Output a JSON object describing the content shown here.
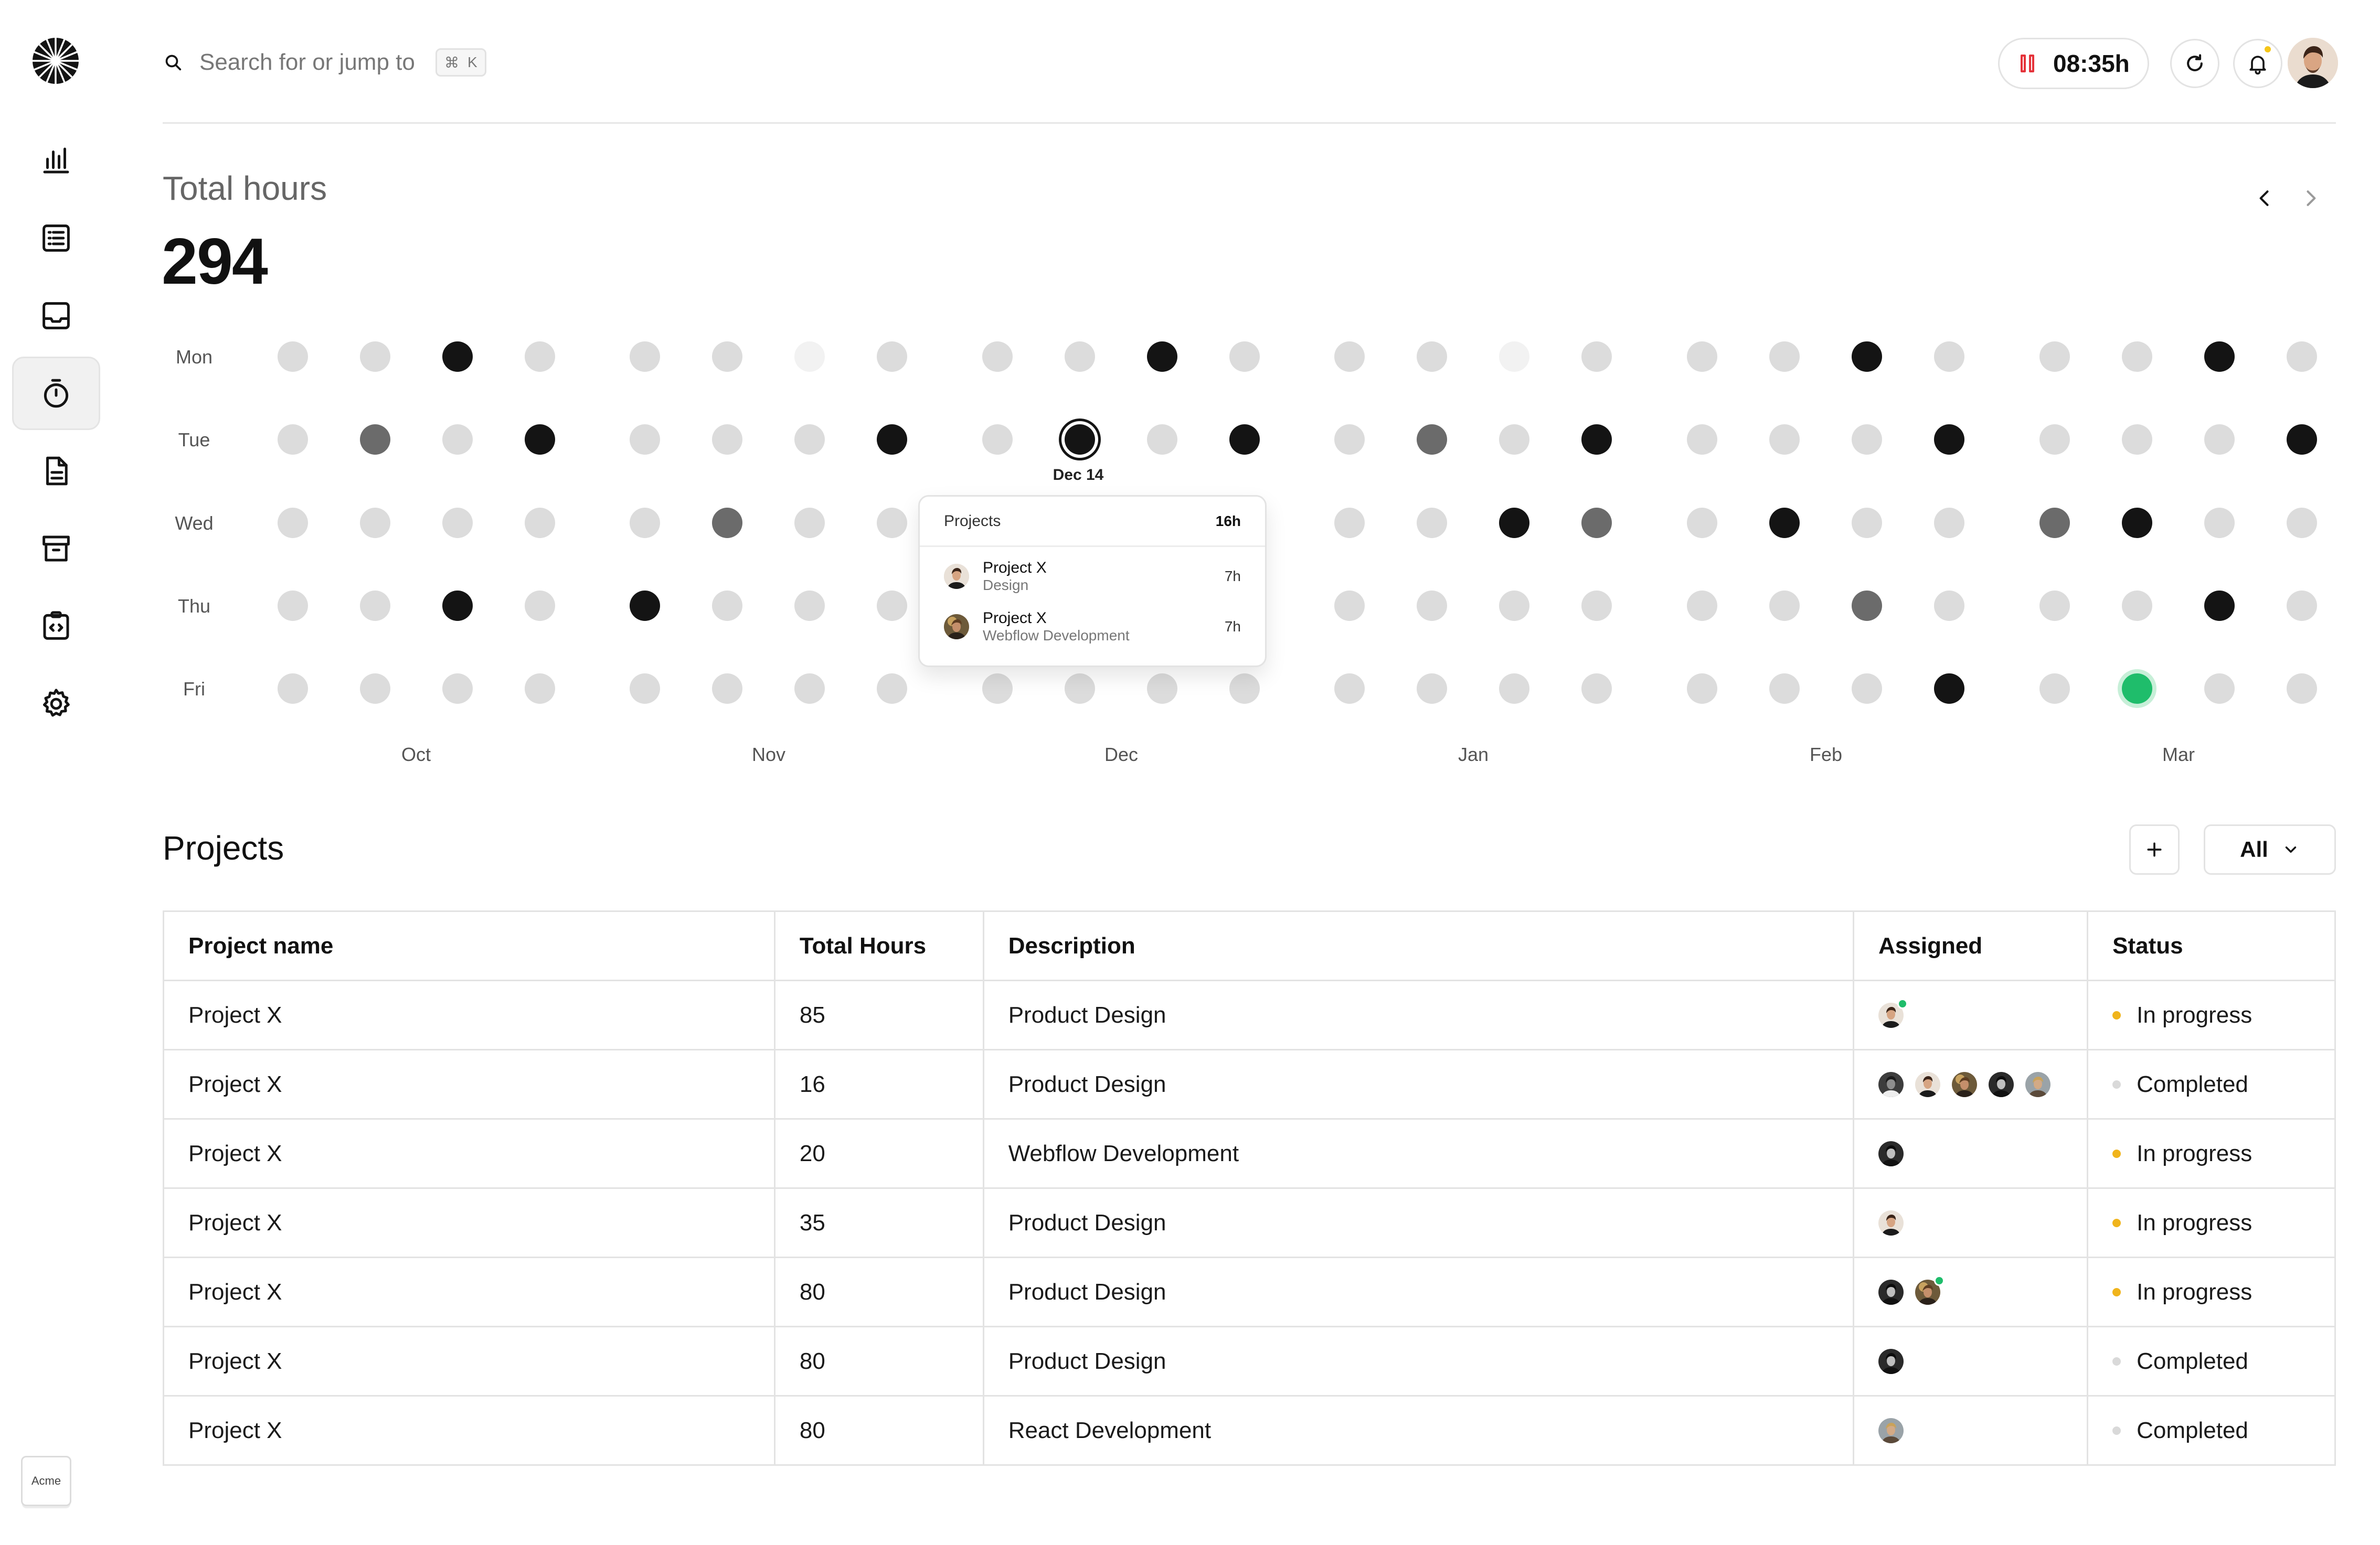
{
  "search": {
    "placeholder": "Search for or jump to",
    "shortcut_cmd": "⌘",
    "shortcut_key": "K"
  },
  "header": {
    "timer": "08:35h"
  },
  "summary": {
    "label": "Total hours",
    "value": "294"
  },
  "heatmap": {
    "days": [
      "Mon",
      "Tue",
      "Wed",
      "Thu",
      "Fri"
    ],
    "months": [
      "Oct",
      "Nov",
      "Dec",
      "Jan",
      "Feb",
      "Mar"
    ],
    "levels": [
      [
        1,
        1,
        3,
        1,
        1,
        1,
        0,
        1,
        1,
        1,
        3,
        1,
        1,
        1,
        0,
        1,
        1,
        1,
        3,
        1,
        1,
        1,
        3,
        1
      ],
      [
        1,
        2,
        1,
        3,
        1,
        1,
        1,
        3,
        1,
        "S",
        1,
        3,
        1,
        2,
        1,
        3,
        1,
        1,
        1,
        3,
        1,
        1,
        1,
        3
      ],
      [
        1,
        1,
        1,
        1,
        1,
        2,
        1,
        1,
        1,
        1,
        1,
        1,
        1,
        1,
        3,
        2,
        1,
        3,
        1,
        1,
        2,
        3,
        1,
        1
      ],
      [
        1,
        1,
        3,
        1,
        3,
        1,
        1,
        1,
        1,
        1,
        1,
        1,
        1,
        1,
        1,
        1,
        1,
        1,
        2,
        1,
        1,
        1,
        3,
        1
      ],
      [
        1,
        1,
        1,
        1,
        1,
        1,
        1,
        1,
        1,
        1,
        1,
        1,
        1,
        1,
        1,
        1,
        1,
        1,
        1,
        3,
        1,
        "T",
        1,
        1
      ]
    ],
    "selected_date": "Dec 14",
    "tooltip": {
      "title": "Projects",
      "total": "16h",
      "rows": [
        {
          "name": "Project X",
          "sub": "Design",
          "hours": "7h"
        },
        {
          "name": "Project X",
          "sub": "Webflow Development",
          "hours": "7h"
        }
      ]
    },
    "colors": {
      "empty": "#f2f2f2",
      "low": "#dcdcdc",
      "mid": "#6b6b6b",
      "high": "#141414",
      "today": "#1fbd6b"
    }
  },
  "projects": {
    "title": "Projects",
    "filter_label": "All",
    "columns": [
      "Project name",
      "Total Hours",
      "Description",
      "Assigned",
      "Status"
    ],
    "rows": [
      {
        "name": "Project X",
        "hours": "85",
        "description": "Product Design",
        "status": "In progress"
      },
      {
        "name": "Project X",
        "hours": "16",
        "description": "Product Design",
        "status": "Completed"
      },
      {
        "name": "Project X",
        "hours": "20",
        "description": "Webflow Development",
        "status": "In progress"
      },
      {
        "name": "Project X",
        "hours": "35",
        "description": "Product Design",
        "status": "In progress"
      },
      {
        "name": "Project X",
        "hours": "80",
        "description": "Product Design",
        "status": "In progress"
      },
      {
        "name": "Project X",
        "hours": "80",
        "description": "Product Design",
        "status": "Completed"
      },
      {
        "name": "Project X",
        "hours": "80",
        "description": "React Development",
        "status": "Completed"
      }
    ],
    "status_colors": {
      "In progress": "#f0b41c",
      "Completed": "#d9d9d9"
    }
  },
  "workspace": {
    "label": "Acme"
  },
  "icons": [
    "logo-icon",
    "chart-icon",
    "list-icon",
    "inbox-icon",
    "timer-icon",
    "document-icon",
    "archive-icon",
    "code-icon",
    "settings-icon",
    "search-icon",
    "refresh-icon",
    "bell-icon",
    "chevron-left-icon",
    "chevron-right-icon",
    "plus-icon",
    "chevron-down-icon"
  ]
}
